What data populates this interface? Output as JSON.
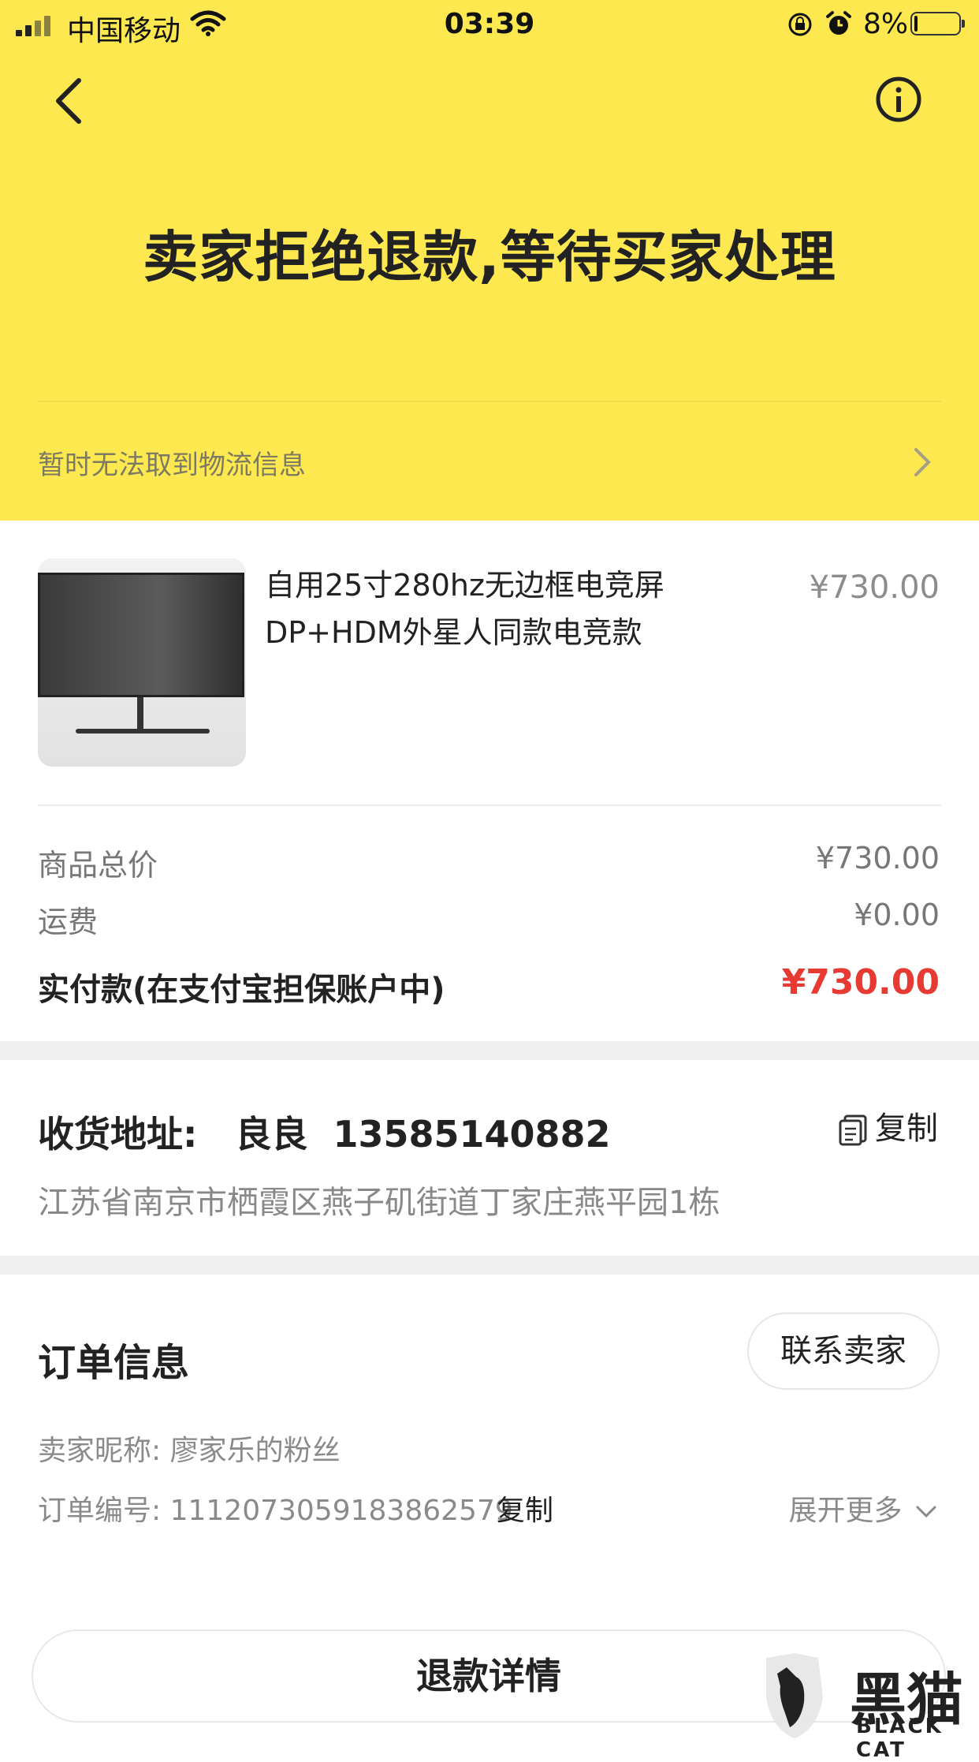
{
  "status_bar": {
    "carrier": "中国移动",
    "time": "03:39",
    "battery_percent": "8%",
    "battery_level": 0.08
  },
  "header": {
    "title": "卖家拒绝退款,等待买家处理",
    "logistics_text": "暂时无法取到物流信息",
    "background_color": "#fde84f"
  },
  "product": {
    "name_line1": "自用25寸280hz无边框电竞屏",
    "name_line2": "DP+HDM外星人同款电竞款",
    "price": "¥730.00"
  },
  "summary": {
    "goods_total_label": "商品总价",
    "goods_total_value": "¥730.00",
    "shipping_label": "运费",
    "shipping_value": "¥0.00",
    "paid_label": "实付款(在支付宝担保账户中)",
    "paid_value": "¥730.00",
    "paid_color": "#e63a32"
  },
  "address": {
    "heading": "收货地址:   良良  13585140882",
    "copy_label": "复制",
    "detail": "江苏省南京市栖霞区燕子矶街道丁家庄燕平园1栋"
  },
  "order_info": {
    "title": "订单信息",
    "contact_seller": "联系卖家",
    "seller_nickname": "卖家昵称: 廖家乐的粉丝",
    "order_number": "订单编号: 1112073059183862579",
    "copy_label": "复制",
    "expand_label": "展开更多"
  },
  "footer": {
    "refund_details": "退款详情"
  },
  "watermark": {
    "text": "黑猫",
    "sub": "BLACK CAT"
  },
  "icons": [
    "signal-icon",
    "wifi-icon",
    "lock-rotation-icon",
    "alarm-icon",
    "battery-icon",
    "back-arrow-icon",
    "info-icon",
    "chevron-right-icon",
    "copy-icon",
    "chevron-down-icon",
    "black-cat-logo-icon"
  ]
}
